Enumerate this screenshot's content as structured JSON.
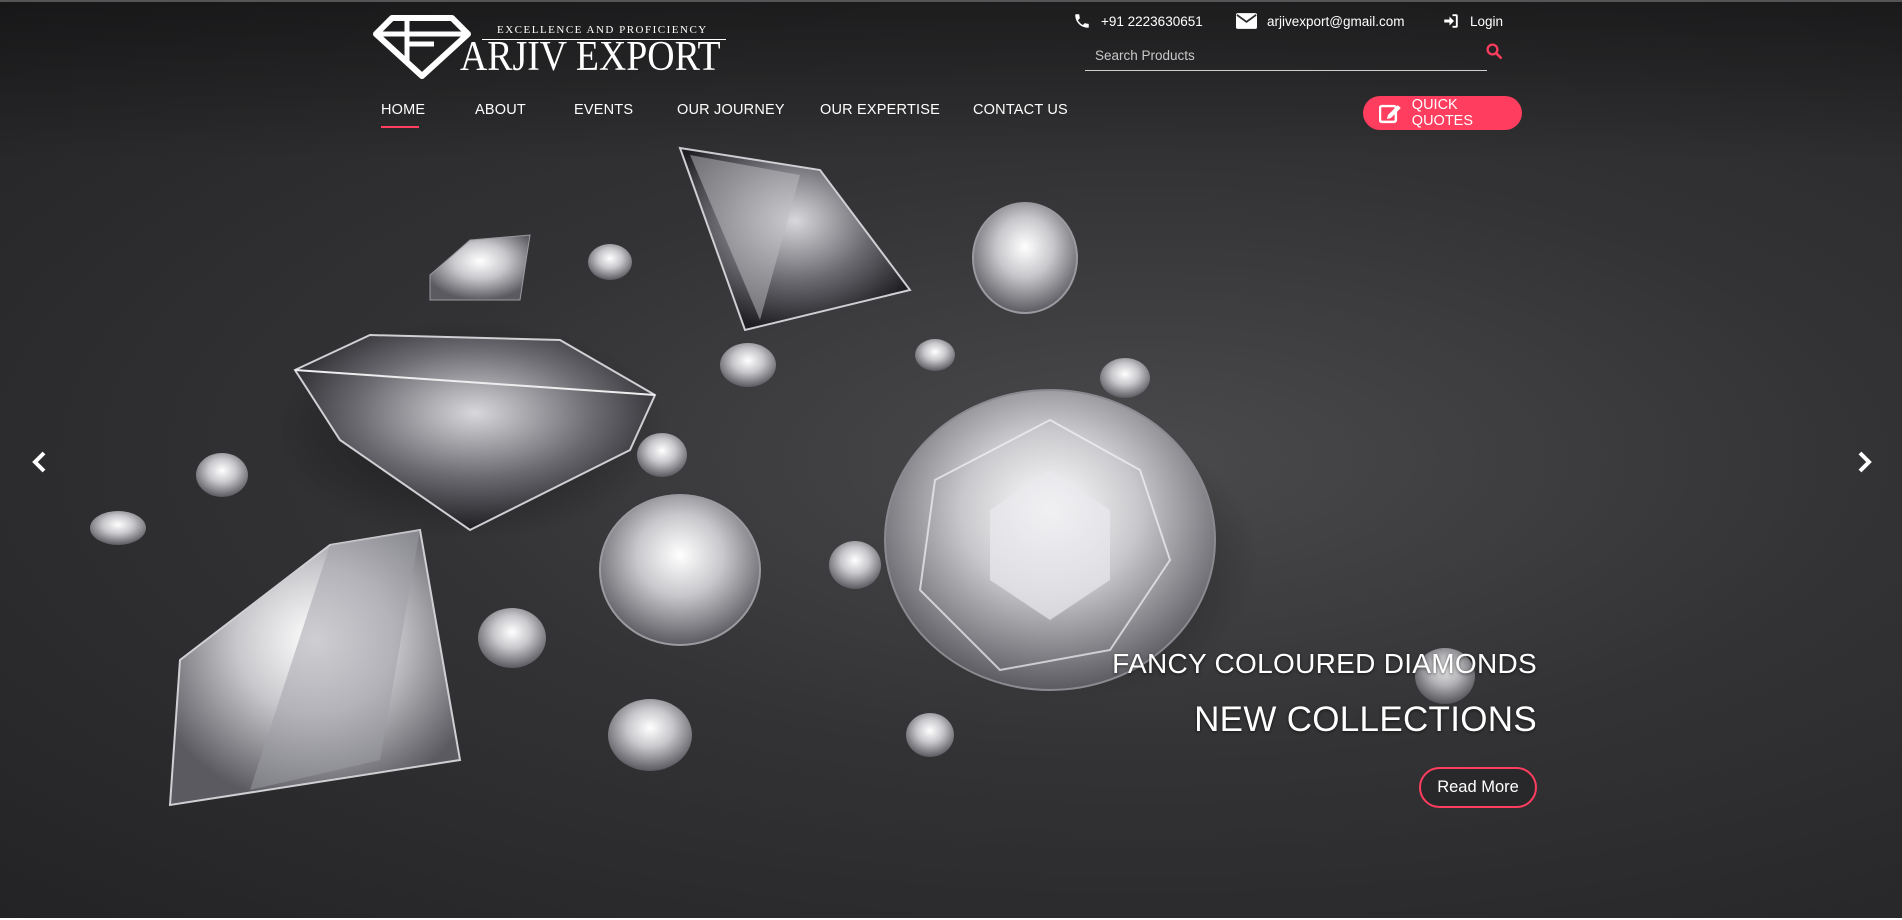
{
  "brand": {
    "tagline": "EXCELLENCE AND PROFICIENCY",
    "name": "ARJIV EXPORT",
    "logo_icon": "diamond-logo-icon"
  },
  "contact": {
    "phone": "+91 2223630651",
    "phone_icon": "phone-icon",
    "email": "arjivexport@gmail.com",
    "email_icon": "envelope-icon",
    "login": "Login",
    "login_icon": "sign-in-icon"
  },
  "search": {
    "placeholder": "Search Products",
    "icon": "search-icon"
  },
  "nav": {
    "items": [
      {
        "label": "HOME",
        "active": true
      },
      {
        "label": "ABOUT"
      },
      {
        "label": "EVENTS"
      },
      {
        "label": "OUR JOURNEY"
      },
      {
        "label": "OUR EXPERTISE"
      },
      {
        "label": "CONTACT US"
      }
    ]
  },
  "quick_quotes": {
    "label": "QUICK QUOTES",
    "icon": "edit-icon"
  },
  "slider": {
    "caption_line1": "FANCY COLOURED DIAMONDS",
    "caption_line2": "NEW COLLECTIONS",
    "button_label": "Read More",
    "prev_icon": "chevron-left-icon",
    "next_icon": "chevron-right-icon"
  },
  "colors": {
    "accent": "#ff3d5f",
    "background": "#2f2f31",
    "text": "#ffffff"
  }
}
